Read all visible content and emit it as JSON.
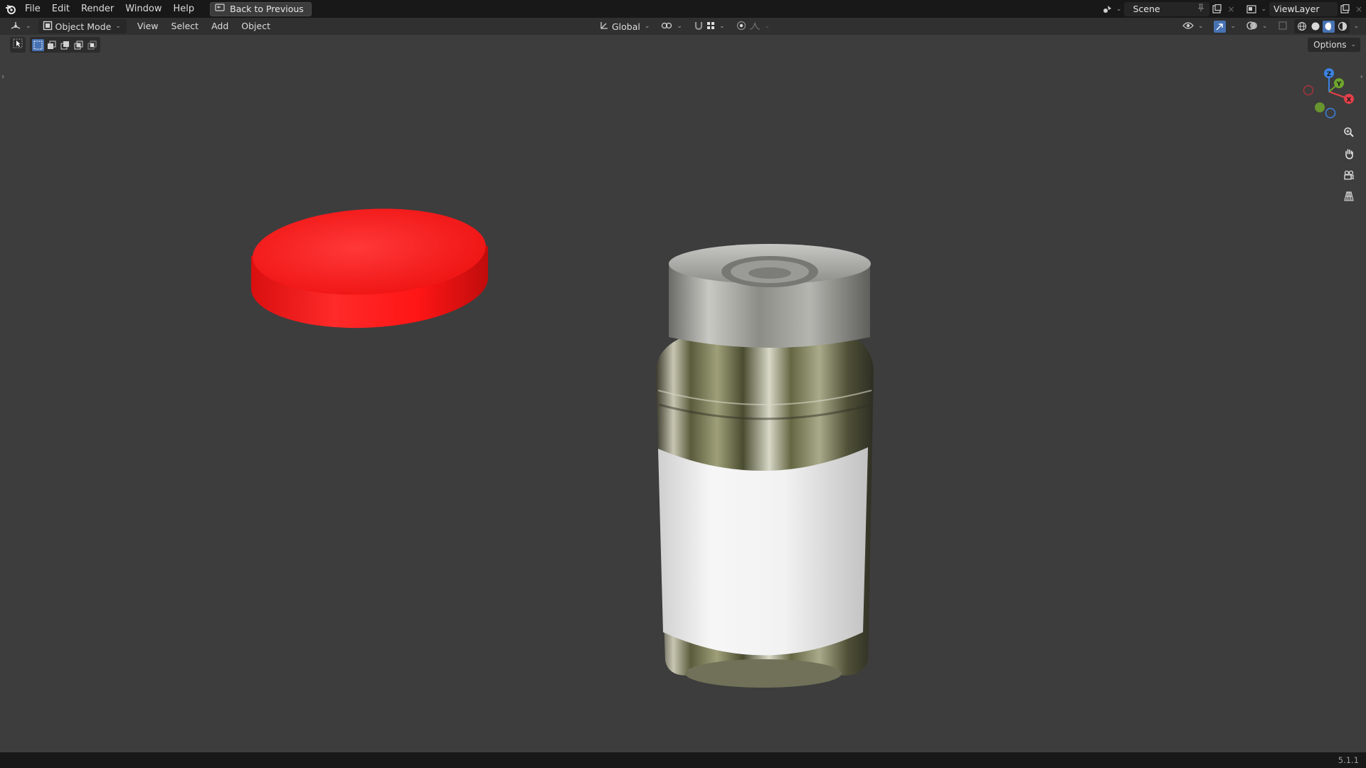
{
  "topbar": {
    "menu": [
      "File",
      "Edit",
      "Render",
      "Window",
      "Help"
    ],
    "back_button": "Back to Previous",
    "scene_name": "Scene",
    "view_layer_name": "ViewLayer"
  },
  "viewport_header": {
    "mode": "Object Mode",
    "menus": [
      "View",
      "Select",
      "Add",
      "Object"
    ],
    "transform_orientation": "Global"
  },
  "tool_settings": {
    "options_label": "Options"
  },
  "scene_objects": {
    "cap_color": "#ff1b1b",
    "label_color": "#f2f2f2",
    "metal_color": "#b8b8b8"
  },
  "gizmo": {
    "axes": [
      "X",
      "Y",
      "Z"
    ],
    "colors": {
      "x": "#e4404a",
      "y": "#6fa52d",
      "z": "#3c82e0"
    }
  },
  "statusbar": {
    "version": "5.1.1"
  }
}
